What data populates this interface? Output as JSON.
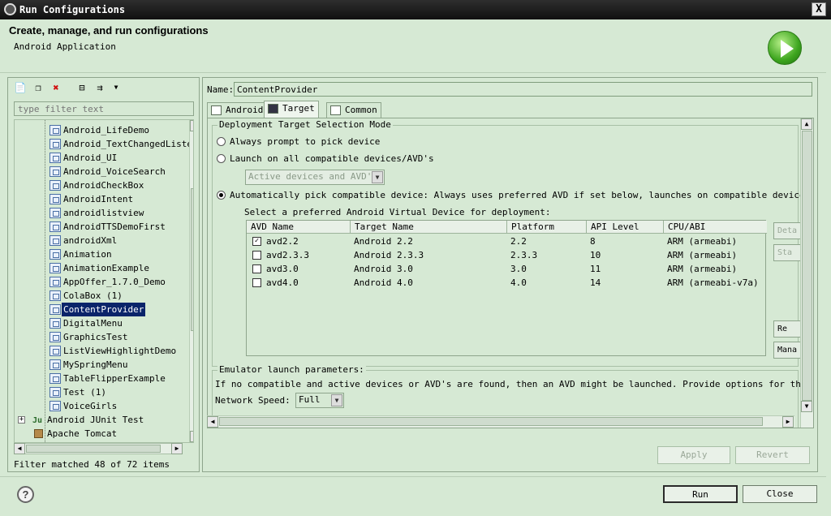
{
  "window": {
    "title": "Run Configurations",
    "close_glyph": "X"
  },
  "header": {
    "title": "Create, manage, and run configurations",
    "subtitle": "Android Application"
  },
  "left": {
    "filter_placeholder": "type filter text",
    "tree_items": [
      "Android_LifeDemo",
      "Android_TextChangedListe",
      "Android_UI",
      "Android_VoiceSearch",
      "AndroidCheckBox",
      "AndroidIntent",
      "androidlistview",
      "AndroidTTSDemoFirst",
      "androidXml",
      "Animation",
      "AnimationExample",
      "AppOffer_1.7.0_Demo",
      "ColaBox (1)",
      "ContentProvider",
      "DigitalMenu",
      "GraphicsTest",
      "ListViewHighlightDemo",
      "MySpringMenu",
      "TableFlipperExample",
      "Test (1)",
      "VoiceGirls"
    ],
    "selected_item": "ContentProvider",
    "category_junit": "Android JUnit Test",
    "category_tomcat": "Apache Tomcat",
    "filter_status": "Filter matched 48 of 72 items"
  },
  "right": {
    "name_label": "Name:",
    "name_value": "ContentProvider",
    "tabs": [
      "Android",
      "Target",
      "Common"
    ],
    "active_tab": "Target",
    "deploy": {
      "group_title": "Deployment Target Selection Mode",
      "opt_prompt": "Always prompt to pick device",
      "opt_all": "Launch on all compatible devices/AVD's",
      "combo_value": "Active devices and AVD's",
      "opt_auto": "Automatically pick compatible device: Always uses preferred AVD if set below, launches on compatible device/AVD other",
      "select_label": "Select a preferred Android Virtual Device for deployment:"
    },
    "table": {
      "headers": [
        "AVD Name",
        "Target Name",
        "Platform",
        "API Level",
        "CPU/ABI"
      ],
      "rows": [
        {
          "checked": true,
          "name": "avd2.2",
          "target": "Android 2.2",
          "platform": "2.2",
          "api": "8",
          "cpu": "ARM (armeabi)"
        },
        {
          "checked": false,
          "name": "avd2.3.3",
          "target": "Android 2.3.3",
          "platform": "2.3.3",
          "api": "10",
          "cpu": "ARM (armeabi)"
        },
        {
          "checked": false,
          "name": "avd3.0",
          "target": "Android 3.0",
          "platform": "3.0",
          "api": "11",
          "cpu": "ARM (armeabi)"
        },
        {
          "checked": false,
          "name": "avd4.0",
          "target": "Android 4.0",
          "platform": "4.0",
          "api": "14",
          "cpu": "ARM (armeabi-v7a)"
        }
      ]
    },
    "side_buttons": [
      "Deta",
      "Sta",
      "Re",
      "Mana"
    ],
    "emulator": {
      "group_title": "Emulator launch parameters:",
      "description": "If no compatible and active devices or AVD's are found, then an AVD might be launched. Provide options for the AVD launc",
      "speed_label": "Network Speed:",
      "speed_value": "Full"
    },
    "apply_label": "Apply",
    "revert_label": "Revert"
  },
  "footer": {
    "run_label": "Run",
    "close_label": "Close",
    "help_glyph": "?"
  },
  "colors": {
    "panel_bg": "#D6E9D4",
    "selection": "#0A246A"
  }
}
